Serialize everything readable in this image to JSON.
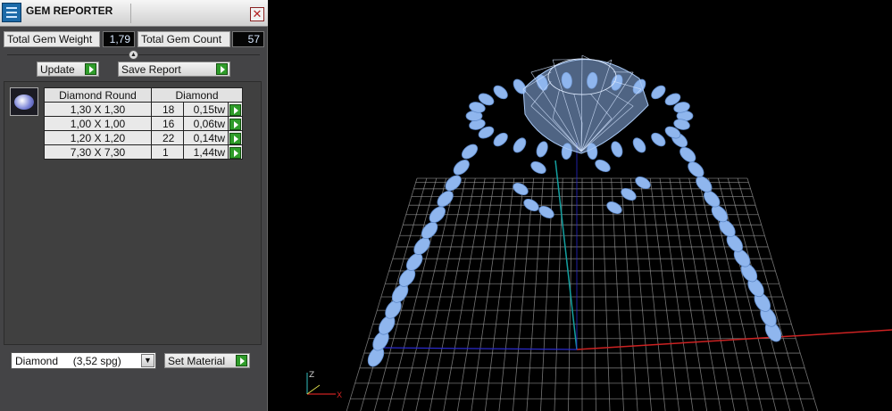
{
  "window": {
    "title": "GEM REPORTER",
    "close_glyph": "✕"
  },
  "stats": {
    "total_weight_label": "Total Gem Weight",
    "total_weight_value": "1,79",
    "total_count_label": "Total Gem Count",
    "total_count_value": "57"
  },
  "toolbar": {
    "update_label": "Update",
    "save_report_label": "Save Report"
  },
  "table": {
    "headers": [
      "Diamond Round",
      "Diamond"
    ],
    "rows": [
      {
        "size": "1,30 X 1,30",
        "count": "18",
        "weight": "0,15tw"
      },
      {
        "size": "1,00 X 1,00",
        "count": "16",
        "weight": "0,06tw"
      },
      {
        "size": "1,20 X 1,20",
        "count": "22",
        "weight": "0,14tw"
      },
      {
        "size": "7,30 X 7,30",
        "count": "1",
        "weight": "1,44tw"
      }
    ]
  },
  "material": {
    "selected": "Diamond     (3,52 spg)",
    "set_label": "Set Material"
  },
  "viewport": {
    "axis_labels": {
      "z": "Z",
      "x": "X"
    },
    "colors": {
      "gem": "#8fb6ee",
      "grid": "#9a9a9a",
      "x_axis": "#cc2222",
      "y_axis": "#2a2acc",
      "z_axis": "#14a0a0"
    }
  },
  "icons": {
    "app": "gem-reporter-app-icon",
    "play": "play-icon",
    "dropdown": "chevron-down-icon"
  }
}
